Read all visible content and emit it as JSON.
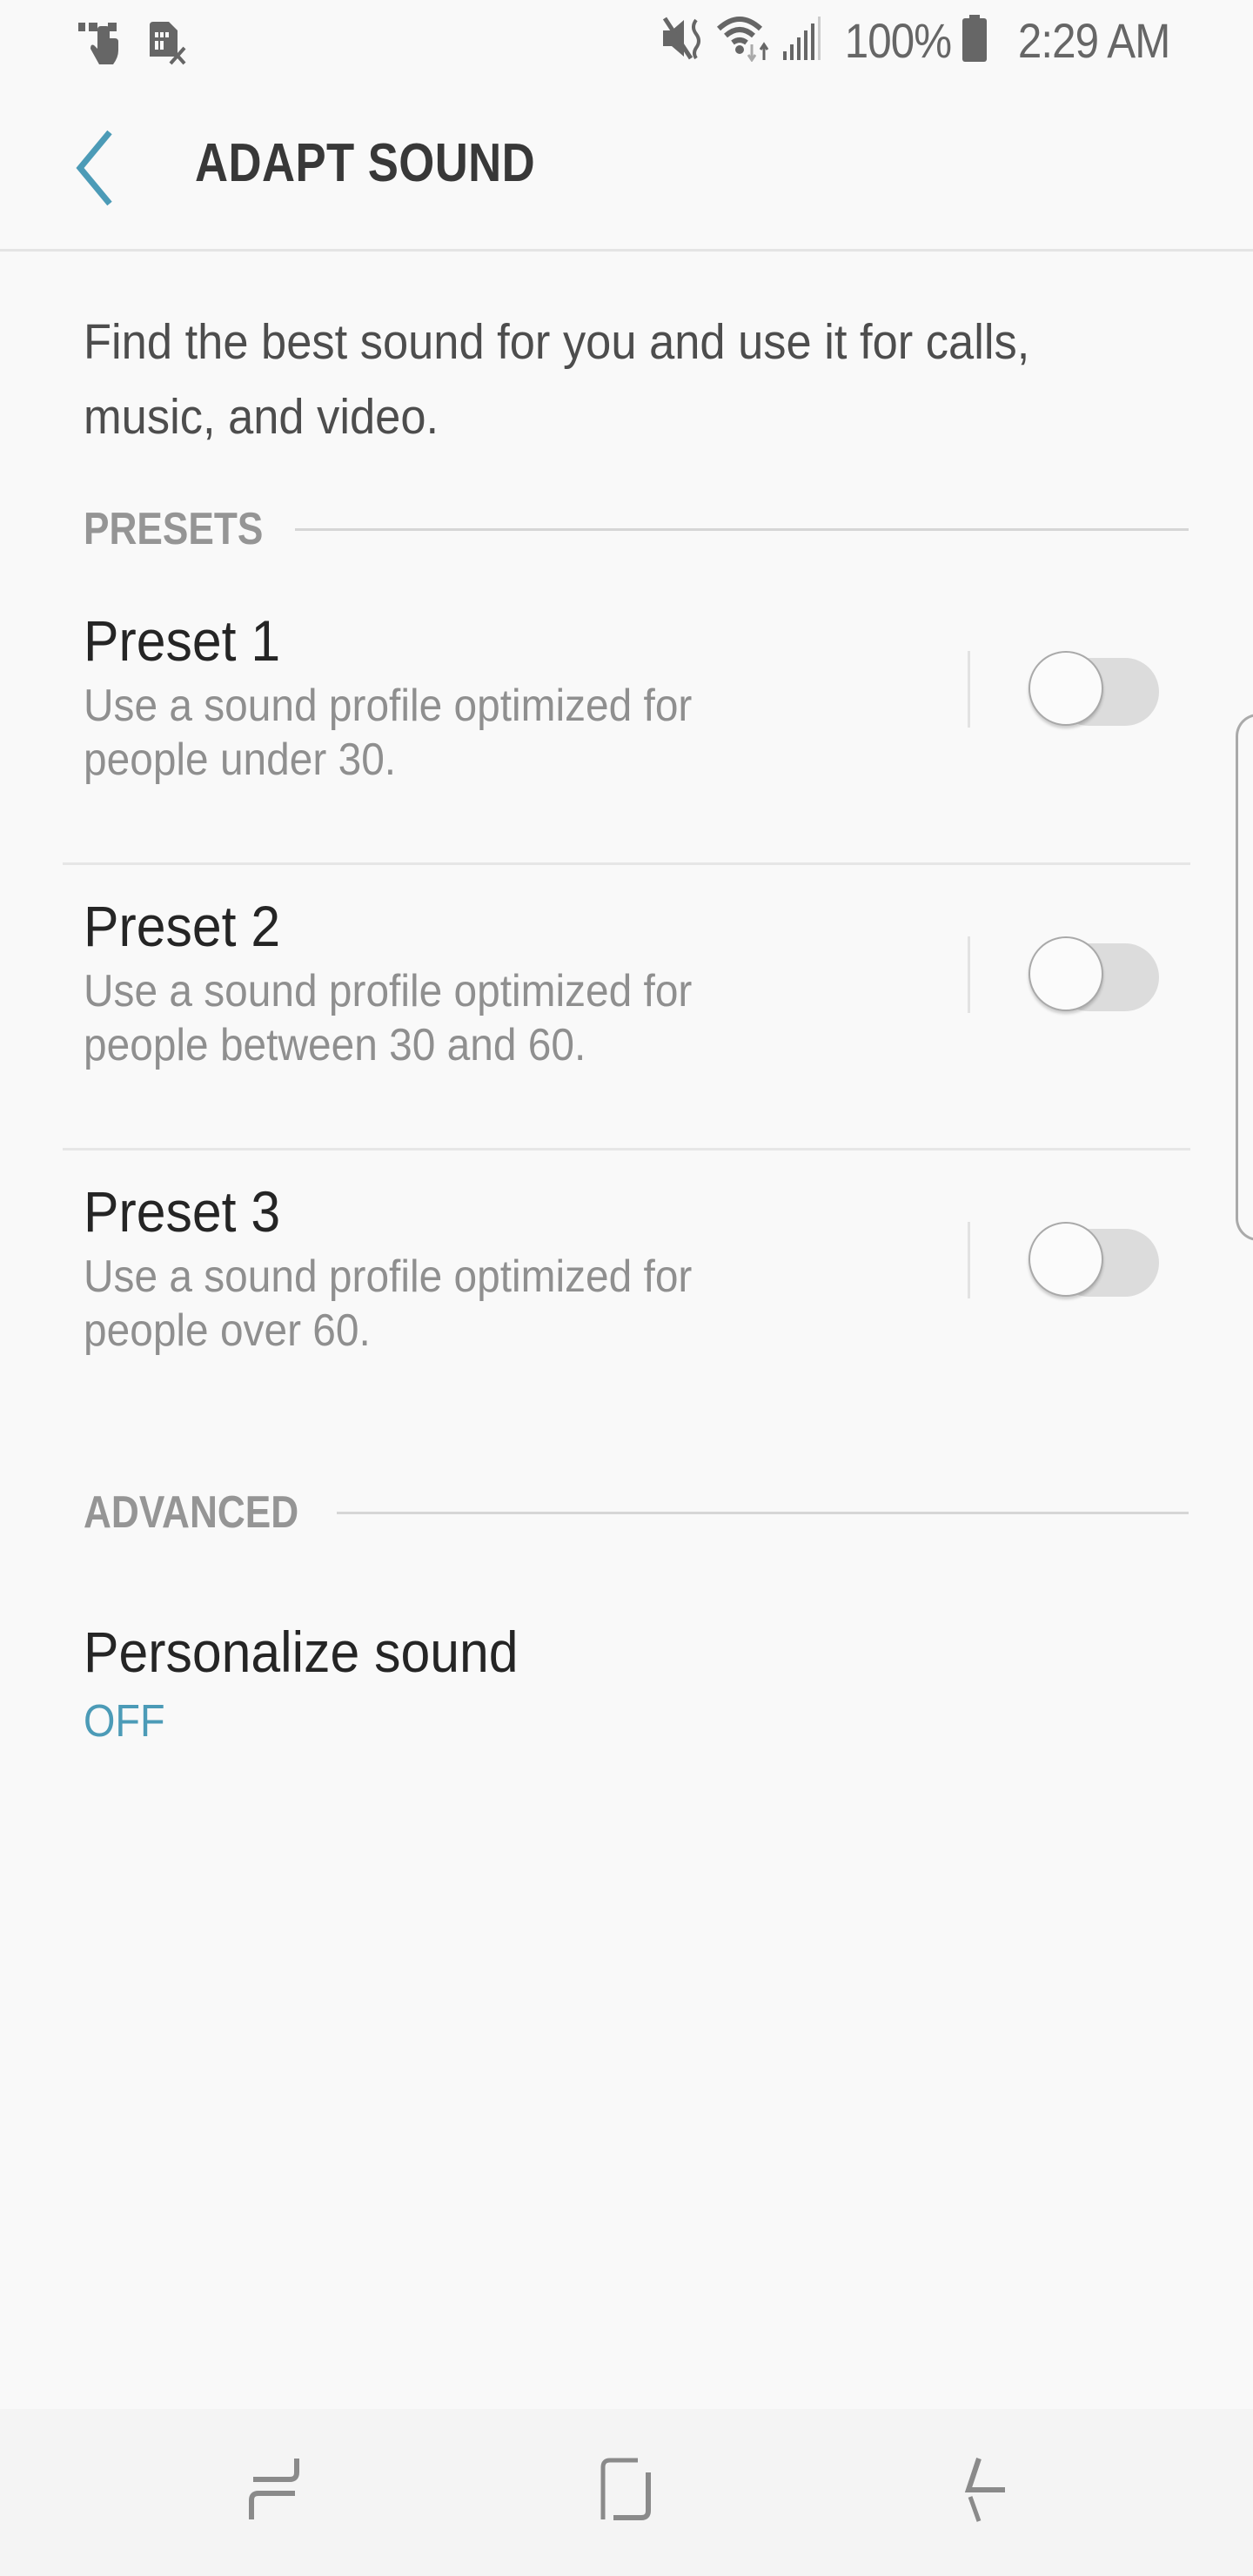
{
  "status_bar": {
    "left_icons": [
      "touch-icon",
      "sim-card-missing-icon"
    ],
    "right_icons": [
      "mute-icon",
      "wifi-data-icon",
      "signal-icon",
      "battery-icon"
    ],
    "battery_percent": "100%",
    "time": "2:29 AM"
  },
  "app_bar": {
    "back_icon": "chevron-left-icon",
    "title": "ADAPT SOUND"
  },
  "description": "Find the best sound for you and use it for calls, music, and video.",
  "sections": {
    "presets": {
      "label": "PRESETS",
      "items": [
        {
          "title": "Preset 1",
          "summary": "Use a sound profile optimized for people under 30.",
          "enabled": false
        },
        {
          "title": "Preset 2",
          "summary": "Use a sound profile optimized for people between 30 and 60.",
          "enabled": false
        },
        {
          "title": "Preset 3",
          "summary": "Use a sound profile optimized for people over 60.",
          "enabled": false
        }
      ]
    },
    "advanced": {
      "label": "ADVANCED",
      "items": [
        {
          "title": "Personalize sound",
          "value": "OFF"
        }
      ]
    }
  },
  "colors": {
    "accent": "#4c9bb7",
    "background": "#f9f9f9",
    "toggle_off_track": "#dcdcdc"
  },
  "nav_bar": {
    "buttons": [
      "recents-icon",
      "home-icon",
      "back-icon"
    ]
  }
}
